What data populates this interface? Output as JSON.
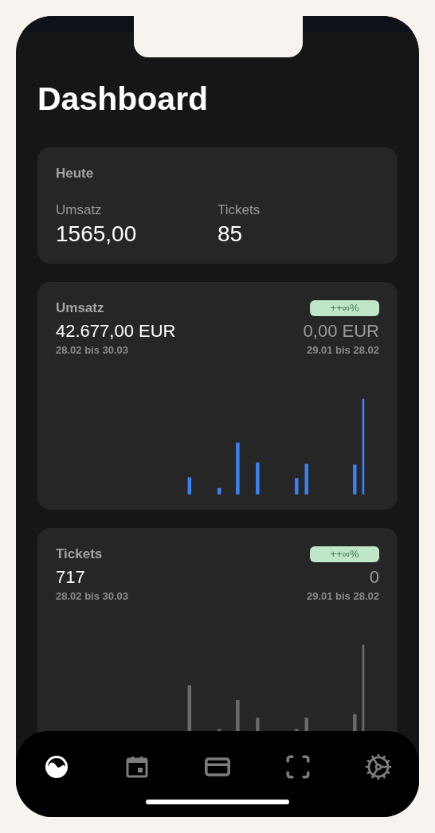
{
  "title": "Dashboard",
  "today": {
    "title": "Heute",
    "stats": [
      {
        "label": "Umsatz",
        "value": "1565,00"
      },
      {
        "label": "Tickets",
        "value": "85"
      }
    ]
  },
  "metrics": [
    {
      "kind": "revenue",
      "title": "Umsatz",
      "badge": "++∞%",
      "value": "42.677,00 EUR",
      "range": "28.02 bis 30.03",
      "prev_value": "0,00 EUR",
      "prev_range": "29.01 bis 28.02"
    },
    {
      "kind": "tickets",
      "title": "Tickets",
      "badge": "++∞%",
      "value": "717",
      "range": "28.02 bis 30.03",
      "prev_value": "0",
      "prev_range": "29.01 bis 28.02"
    }
  ],
  "tabs": [
    {
      "kind": "dashboard",
      "selected": true
    },
    {
      "kind": "calendar",
      "selected": false
    },
    {
      "kind": "card",
      "selected": false
    },
    {
      "kind": "scan",
      "selected": false
    },
    {
      "kind": "settings",
      "selected": false
    }
  ]
}
